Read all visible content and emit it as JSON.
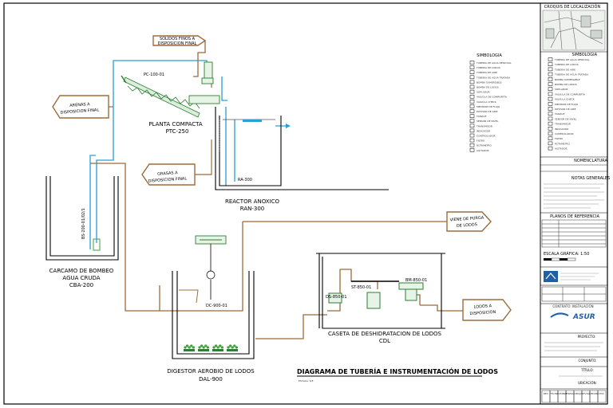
{
  "drawing": {
    "title": "DIAGRAMA DE TUBERÍA E INSTRUMENTACIÓN DE LODOS",
    "scale_note": "ESCALA: S/E"
  },
  "units": {
    "planta": {
      "name": "PLANTA COMPACTA",
      "tag": "PTC-250"
    },
    "reactor": {
      "name": "REACTOR ANOXICO",
      "tag": "RAN-300"
    },
    "carcamo": {
      "name1": "CARCAMO DE BOMBEO",
      "name2": "AGUA CRUDA",
      "tag": "CBA-200"
    },
    "digestor": {
      "name": "DIGESTOR AEROBIO DE LODOS",
      "tag": "DAL-900"
    },
    "caseta": {
      "name": "CASETA DE DESHIDRATACION DE LODOS",
      "tag": "CDL"
    }
  },
  "flags": {
    "solidos": [
      "SOLIDOS FINOS A",
      "DISPOSICION FINAL"
    ],
    "arenas": [
      "ARENAS A",
      "DISPOSICION FINAL"
    ],
    "grasas": [
      "GRASAS A",
      "DISPOSICION FINAL"
    ],
    "purga": [
      "VIENE DE PURGA",
      "DE LODOS"
    ],
    "lodos": [
      "LODOS A",
      "DISPOSICION"
    ]
  },
  "tags": {
    "pc": "PC-100-01",
    "ra": "RA-300",
    "bs": "BS-200-01/02/1",
    "dc": "DC-900-01",
    "st": "ST-850-01",
    "bm": "BM-850-01",
    "ds": "DS-850-01"
  },
  "legend": {
    "title": "SIMBOLOGIA",
    "items": [
      "TUBERIA DE AGUA RESIDUAL",
      "TUBERIA DE LODOS",
      "TUBERIA DE AIRE",
      "TUBERIA DE AGUA TRATADA",
      "BOMBA SUMERGIBLE",
      "BOMBA DE LODOS",
      "SOPLADOR",
      "VALVULA DE COMPUERTA",
      "VALVULA CHECK",
      "MEDIDOR DE FLUJO",
      "DIFUSOR DE AIRE",
      "TANQUE",
      "SENSOR DE NIVEL",
      "TRANSMISOR",
      "INDICADOR",
      "CONTROLADOR",
      "FILTRO",
      "ROTAMETRO",
      "AGITADOR"
    ]
  },
  "title_block": {
    "croquis": "CROQUIS DE LOCALIZACIÓN",
    "simbologia": "SIMBOLOGIA",
    "nomenclatura": "NOMENCLATURA",
    "notas": "NOTAS GENERALES",
    "planos": "PLANOS DE REFERENCIA",
    "escala": "ESCALA GRÁFICA: 1:50",
    "contratista": "CONTRATO: INSTALACIÓN",
    "client": "ASUR",
    "proyecto": "PROYECTO:",
    "conjunto": "CONJUNTO:",
    "titulo": "TÍTULO:",
    "ubicacion": "UBICACIÓN:",
    "footer": [
      "REV",
      "FECHA",
      "NOMBRE",
      "FIRMA",
      "DIBUJÓ",
      "REVISÓ",
      "APROBÓ",
      "ESC"
    ]
  },
  "colors": {
    "sludge": "#9c6b3c",
    "water": "#2a9fd6",
    "diffuser": "#3aa335",
    "equipment": "#2e7d32"
  }
}
